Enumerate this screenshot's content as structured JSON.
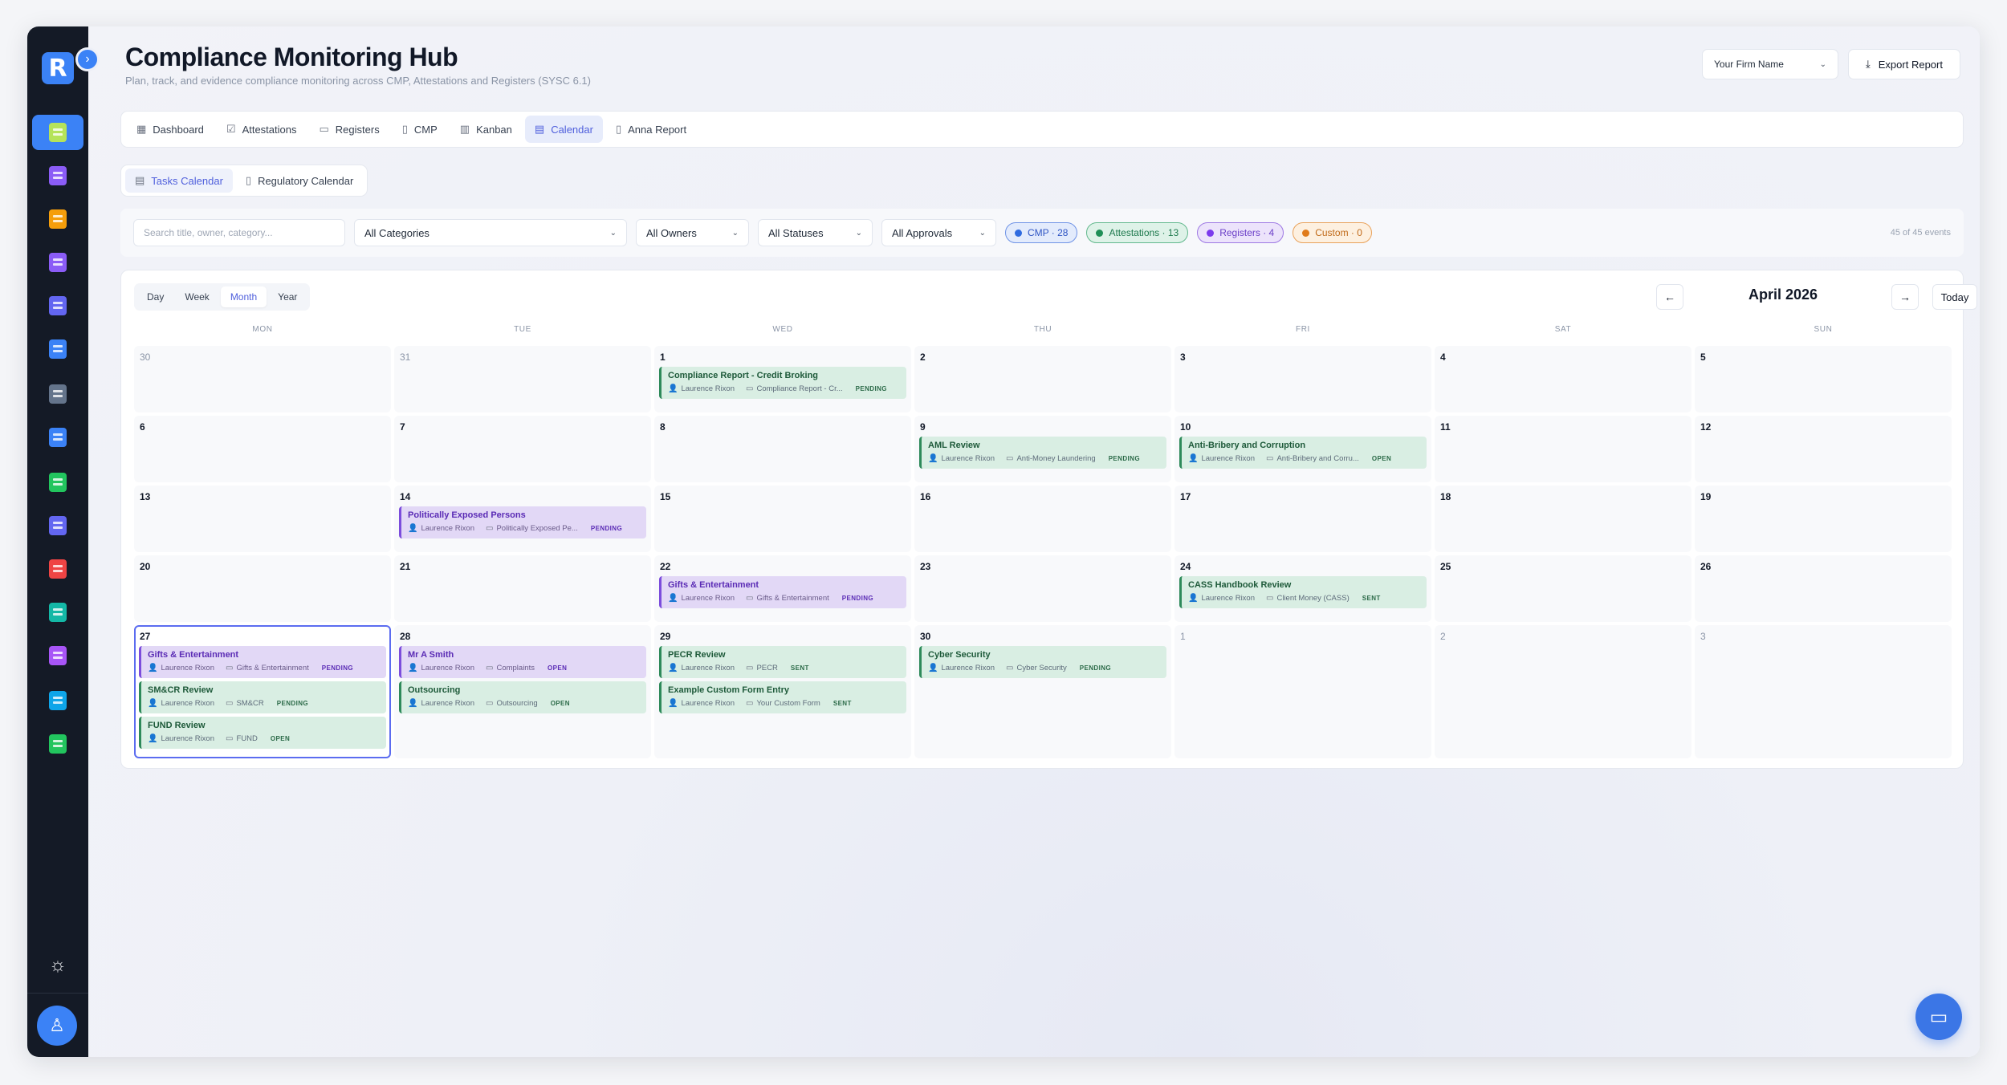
{
  "header": {
    "title": "Compliance Monitoring Hub",
    "subtitle": "Plan, track, and evidence compliance monitoring across CMP, Attestations and Registers (SYSC 6.1)",
    "firm_select": "Your Firm Name",
    "export_label": "Export Report"
  },
  "sidebar": {
    "logo": "R",
    "items": [
      {
        "icon": "compliance-doc-icon",
        "color": "#84cc16",
        "active": true
      },
      {
        "icon": "policy-doc-icon",
        "color": "#8b5cf6"
      },
      {
        "icon": "building-icon",
        "color": "#f59e0b"
      },
      {
        "icon": "users-icon",
        "color": "#8b5cf6"
      },
      {
        "icon": "shield-icon",
        "color": "#6366f1"
      },
      {
        "icon": "chart-icon",
        "color": "#3b82f6"
      },
      {
        "icon": "news-icon",
        "color": "#64748b"
      },
      {
        "icon": "monitor-icon",
        "color": "#3b82f6"
      },
      {
        "icon": "badge-icon",
        "color": "#22c55e"
      },
      {
        "icon": "target-icon",
        "color": "#6366f1"
      },
      {
        "icon": "search-doc-icon",
        "color": "#ef4444"
      },
      {
        "icon": "lock-icon",
        "color": "#14b8a6"
      },
      {
        "icon": "list-icon",
        "color": "#a855f7"
      },
      {
        "icon": "report-icon",
        "color": "#0ea5e9"
      },
      {
        "icon": "card-icon",
        "color": "#22c55e"
      }
    ]
  },
  "tabs": [
    {
      "label": "Dashboard",
      "icon": "▦"
    },
    {
      "label": "Attestations",
      "icon": "☑"
    },
    {
      "label": "Registers",
      "icon": "▭"
    },
    {
      "label": "CMP",
      "icon": "▯"
    },
    {
      "label": "Kanban",
      "icon": "▥"
    },
    {
      "label": "Calendar",
      "icon": "▤",
      "active": true
    },
    {
      "label": "Anna Report",
      "icon": "▯"
    }
  ],
  "sub_tabs": [
    {
      "label": "Tasks Calendar",
      "active": true
    },
    {
      "label": "Regulatory Calendar"
    }
  ],
  "filters": {
    "search_placeholder": "Search title, owner, category...",
    "categories": "All Categories",
    "owners": "All Owners",
    "statuses": "All Statuses",
    "approvals": "All Approvals",
    "chips": {
      "cmp": "CMP · 28",
      "attestations": "Attestations · 13",
      "registers": "Registers · 4",
      "custom": "Custom · 0"
    },
    "count": "45 of 45 events"
  },
  "calendar": {
    "views": [
      "Day",
      "Week",
      "Month",
      "Year"
    ],
    "active_view": "Month",
    "month_label": "April 2026",
    "prev": "←",
    "next": "→",
    "today": "Today",
    "weekdays": [
      "MON",
      "TUE",
      "WED",
      "THU",
      "FRI",
      "SAT",
      "SUN"
    ],
    "weeks": [
      [
        {
          "day": "30",
          "muted": true,
          "events": []
        },
        {
          "day": "31",
          "muted": true,
          "events": []
        },
        {
          "day": "1",
          "events": [
            {
              "title": "Compliance Report - Credit Broking",
              "owner": "Laurence Rixon",
              "category": "Compliance Report - Cr...",
              "status": "PENDING",
              "color": "green"
            }
          ]
        },
        {
          "day": "2",
          "events": []
        },
        {
          "day": "3",
          "events": []
        },
        {
          "day": "4",
          "events": []
        },
        {
          "day": "5",
          "events": []
        }
      ],
      [
        {
          "day": "6",
          "events": []
        },
        {
          "day": "7",
          "events": []
        },
        {
          "day": "8",
          "events": []
        },
        {
          "day": "9",
          "events": [
            {
              "title": "AML Review",
              "owner": "Laurence Rixon",
              "category": "Anti-Money Laundering",
              "status": "PENDING",
              "color": "green"
            }
          ]
        },
        {
          "day": "10",
          "events": [
            {
              "title": "Anti-Bribery and Corruption",
              "owner": "Laurence Rixon",
              "category": "Anti-Bribery and Corru...",
              "status": "OPEN",
              "color": "green"
            }
          ]
        },
        {
          "day": "11",
          "events": []
        },
        {
          "day": "12",
          "events": []
        }
      ],
      [
        {
          "day": "13",
          "events": []
        },
        {
          "day": "14",
          "events": [
            {
              "title": "Politically Exposed Persons",
              "owner": "Laurence Rixon",
              "category": "Politically Exposed Pe...",
              "status": "PENDING",
              "color": "purple"
            }
          ]
        },
        {
          "day": "15",
          "events": []
        },
        {
          "day": "16",
          "events": []
        },
        {
          "day": "17",
          "events": []
        },
        {
          "day": "18",
          "events": []
        },
        {
          "day": "19",
          "events": []
        }
      ],
      [
        {
          "day": "20",
          "events": []
        },
        {
          "day": "21",
          "events": []
        },
        {
          "day": "22",
          "events": [
            {
              "title": "Gifts & Entertainment",
              "owner": "Laurence Rixon",
              "category": "Gifts & Entertainment",
              "status": "PENDING",
              "color": "purple"
            }
          ]
        },
        {
          "day": "23",
          "events": []
        },
        {
          "day": "24",
          "events": [
            {
              "title": "CASS Handbook Review",
              "owner": "Laurence Rixon",
              "category": "Client Money (CASS)",
              "status": "SENT",
              "color": "green"
            }
          ]
        },
        {
          "day": "25",
          "events": []
        },
        {
          "day": "26",
          "events": []
        }
      ],
      [
        {
          "day": "27",
          "today": true,
          "events": [
            {
              "title": "Gifts & Entertainment",
              "owner": "Laurence Rixon",
              "category": "Gifts & Entertainment",
              "status": "PENDING",
              "color": "purple"
            },
            {
              "title": "SM&CR Review",
              "owner": "Laurence Rixon",
              "category": "SM&CR",
              "status": "PENDING",
              "color": "green"
            },
            {
              "title": "FUND Review",
              "owner": "Laurence Rixon",
              "category": "FUND",
              "status": "OPEN",
              "color": "green"
            }
          ]
        },
        {
          "day": "28",
          "events": [
            {
              "title": "Mr A Smith",
              "owner": "Laurence Rixon",
              "category": "Complaints",
              "status": "OPEN",
              "color": "purple"
            },
            {
              "title": "Outsourcing",
              "owner": "Laurence Rixon",
              "category": "Outsourcing",
              "status": "OPEN",
              "color": "green"
            }
          ]
        },
        {
          "day": "29",
          "events": [
            {
              "title": "PECR Review",
              "owner": "Laurence Rixon",
              "category": "PECR",
              "status": "SENT",
              "color": "green"
            },
            {
              "title": "Example Custom Form Entry",
              "owner": "Laurence Rixon",
              "category": "Your Custom Form",
              "status": "SENT",
              "color": "green"
            }
          ]
        },
        {
          "day": "30",
          "events": [
            {
              "title": "Cyber Security",
              "owner": "Laurence Rixon",
              "category": "Cyber Security",
              "status": "PENDING",
              "color": "green"
            }
          ]
        },
        {
          "day": "1",
          "muted": true,
          "events": []
        },
        {
          "day": "2",
          "muted": true,
          "events": []
        },
        {
          "day": "3",
          "muted": true,
          "events": []
        }
      ]
    ]
  },
  "theme": {
    "accent": "#3b82f6",
    "sidebar_bg": "#141a26"
  }
}
